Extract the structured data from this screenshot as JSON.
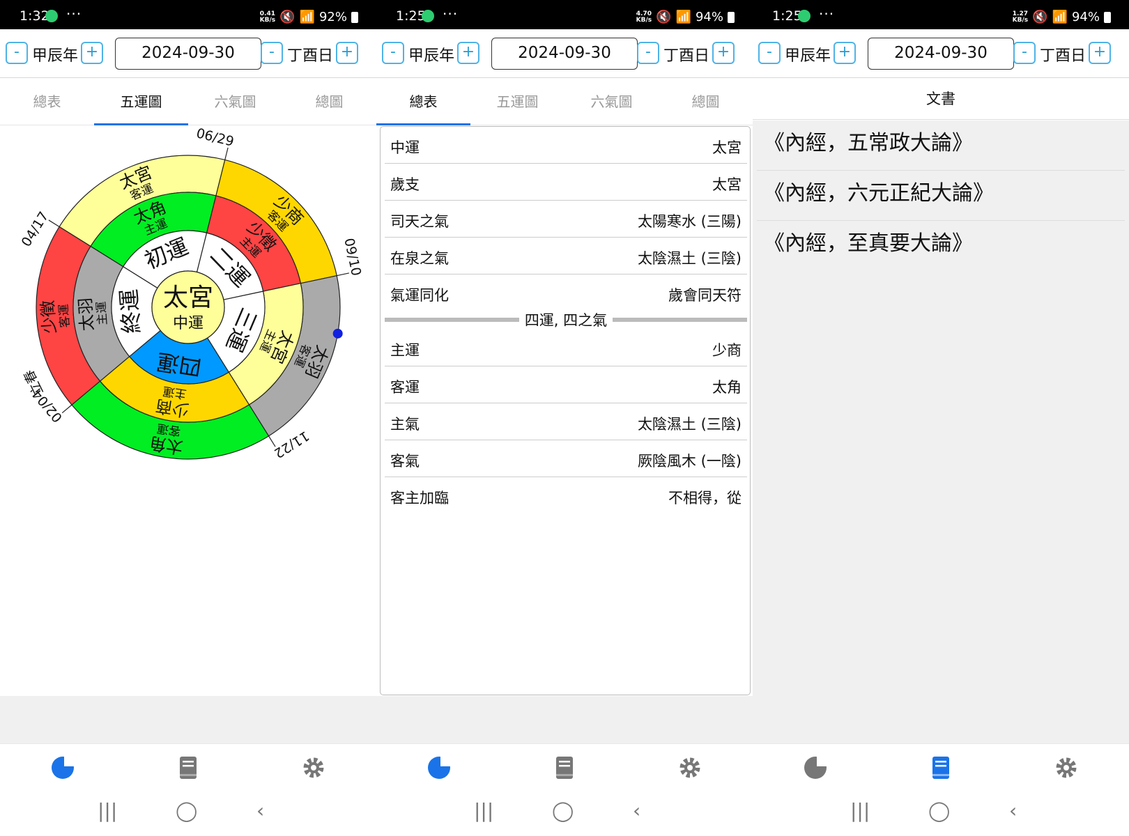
{
  "panels": [
    {
      "status": {
        "time": "1:32",
        "speed_top": "0.41",
        "speed_bottom": "KB/s",
        "battery": "92%"
      },
      "toolbar": {
        "minus": "-",
        "plus": "+",
        "year": "甲辰年",
        "date": "2024-09-30",
        "day": "丁酉日"
      },
      "tabs": [
        "總表",
        "五運圖",
        "六氣圖",
        "總圖"
      ],
      "active_tab": 1
    },
    {
      "status": {
        "time": "1:25",
        "speed_top": "4.70",
        "speed_bottom": "KB/s",
        "battery": "94%"
      },
      "toolbar": {
        "minus": "-",
        "plus": "+",
        "year": "甲辰年",
        "date": "2024-09-30",
        "day": "丁酉日"
      },
      "tabs": [
        "總表",
        "五運圖",
        "六氣圖",
        "總圖"
      ],
      "active_tab": 0
    },
    {
      "status": {
        "time": "1:25",
        "speed_top": "1.27",
        "speed_bottom": "KB/s",
        "battery": "94%"
      },
      "toolbar": {
        "minus": "-",
        "plus": "+",
        "year": "甲辰年",
        "date": "2024-09-30",
        "day": "丁酉日"
      }
    }
  ],
  "wheel": {
    "center_main": "太宮",
    "center_sub": "中運",
    "inner": [
      "初運",
      "二運",
      "三運",
      "四運",
      "終運"
    ],
    "main_ring": [
      {
        "name": "太角",
        "label": "主運",
        "color": "#00ee22"
      },
      {
        "name": "少徵",
        "label": "主運",
        "color": "#ff4444"
      },
      {
        "name": "太宮",
        "label": "主運",
        "color": "#ffff99"
      },
      {
        "name": "少商",
        "label": "主運",
        "color": "#ffd700"
      },
      {
        "name": "太羽",
        "label": "主運",
        "color": "#aaaaaa"
      }
    ],
    "guest_ring": [
      {
        "name": "太宮",
        "label": "客運",
        "color": "#ffff99"
      },
      {
        "name": "少商",
        "label": "客運",
        "color": "#ffd700"
      },
      {
        "name": "太羽",
        "label": "客運",
        "color": "#aaaaaa"
      },
      {
        "name": "太角",
        "label": "客運",
        "color": "#00ee22"
      },
      {
        "name": "少徵",
        "label": "客運",
        "color": "#ff4444"
      }
    ],
    "current_inner_color": "#0099ff",
    "center_color": "#ffff99",
    "dates": [
      "04/17",
      "06/29",
      "09/10",
      "11/22",
      "02/04"
    ],
    "date_extra": "立春"
  },
  "summary": {
    "rows_top": [
      {
        "label": "中運",
        "value": "太宮"
      },
      {
        "label": "歲支",
        "value": "太宮"
      },
      {
        "label": "司天之氣",
        "value": "太陽寒水 (三陽)"
      },
      {
        "label": "在泉之氣",
        "value": "太陰濕土 (三陰)"
      },
      {
        "label": "氣運同化",
        "value": "歲會同天符"
      }
    ],
    "divider": "四運, 四之氣",
    "rows_bottom": [
      {
        "label": "主運",
        "value": "少商"
      },
      {
        "label": "客運",
        "value": "太角"
      },
      {
        "label": "主氣",
        "value": "太陰濕土 (三陰)"
      },
      {
        "label": "客氣",
        "value": "厥陰風木 (一陰)"
      },
      {
        "label": "客主加臨",
        "value": "不相得，從"
      }
    ]
  },
  "docs": {
    "title": "文書",
    "items": [
      "《內經，五常政大論》",
      "《內經，六元正紀大論》",
      "《內經，至真要大論》"
    ]
  },
  "nav": {
    "icons": [
      "pie-chart-icon",
      "book-icon",
      "gear-icon"
    ],
    "active_color": "#1a73e8",
    "inactive_color": "#777777",
    "active_per_panel": [
      0,
      0,
      1
    ]
  },
  "sysnav": {
    "recent": "|||",
    "home": "◯",
    "back": "‹"
  }
}
